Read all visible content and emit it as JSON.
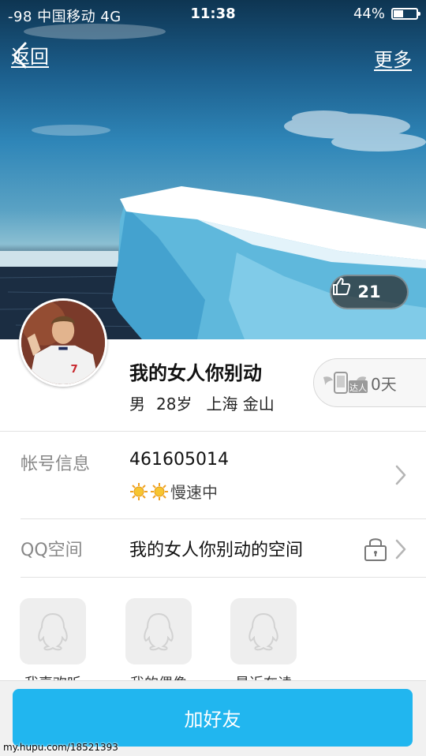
{
  "status_bar": {
    "carrier": "-98 中国移动  4G",
    "time": "11:38",
    "battery_text": "44%",
    "battery_level": 0.44
  },
  "nav": {
    "back_label": "返回",
    "more_label": "更多"
  },
  "cover": {
    "like_count": "21"
  },
  "profile": {
    "nickname": "我的女人你别动",
    "gender": "男",
    "age": "28岁",
    "location": "上海 金山",
    "badge_text": "达人",
    "badge_days": "0天"
  },
  "account": {
    "label": "帐号信息",
    "number": "461605014",
    "speed_text": "慢速中"
  },
  "qzone": {
    "label": "QQ空间",
    "name": "我的女人你别动的空间"
  },
  "tiles": [
    {
      "label": "我喜欢听"
    },
    {
      "label": "我的偶像"
    },
    {
      "label": "最近在读"
    }
  ],
  "actions": {
    "add_friend_label": "加好友"
  },
  "watermark": "my.hupu.com/18521393",
  "colors": {
    "primary_button": "#21b6ef",
    "label_gray": "#888888"
  }
}
